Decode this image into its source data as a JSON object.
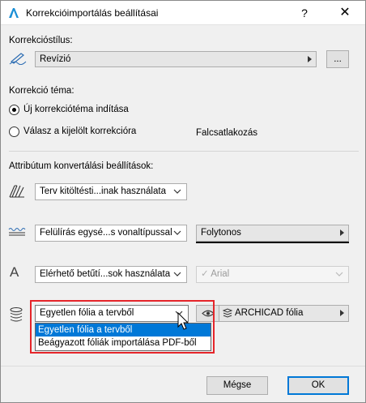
{
  "window": {
    "title": "Korrekcióimportálás beállításai",
    "help": "?",
    "close": "✕"
  },
  "style_section": {
    "label": "Korrekcióstílus:",
    "value": "Revízió",
    "browse": "..."
  },
  "topic_section": {
    "label": "Korrekció téma:",
    "options": [
      {
        "label": "Új korrekciótéma indítása",
        "checked": true
      },
      {
        "label": "Válasz a kijelölt korrekcióra",
        "checked": false
      }
    ],
    "side_text": "Falcsatlakozás"
  },
  "attr_section": {
    "label": "Attribútum konvertálási beállítások:",
    "fill_select": "Terv kitöltésti...inak használata",
    "line_select": "Felülírás egysé...s vonaltípussal",
    "line_type": "Folytonos",
    "font_select": "Elérhető betűtí...sok használata",
    "font_value": "Arial",
    "layer_select": "Egyetlen fólia a tervből",
    "layer_value": "ARCHICAD fólia"
  },
  "dropdown": {
    "items": [
      {
        "label": "Egyetlen fólia a tervből",
        "selected": true
      },
      {
        "label": "Beágyazott fóliák importálása PDF-ből",
        "selected": false
      }
    ]
  },
  "buttons": {
    "cancel": "Mégse",
    "ok": "OK"
  },
  "colors": {
    "highlight": "#0078d7",
    "callout": "#e5252a",
    "ok_border": "#0078d7"
  }
}
